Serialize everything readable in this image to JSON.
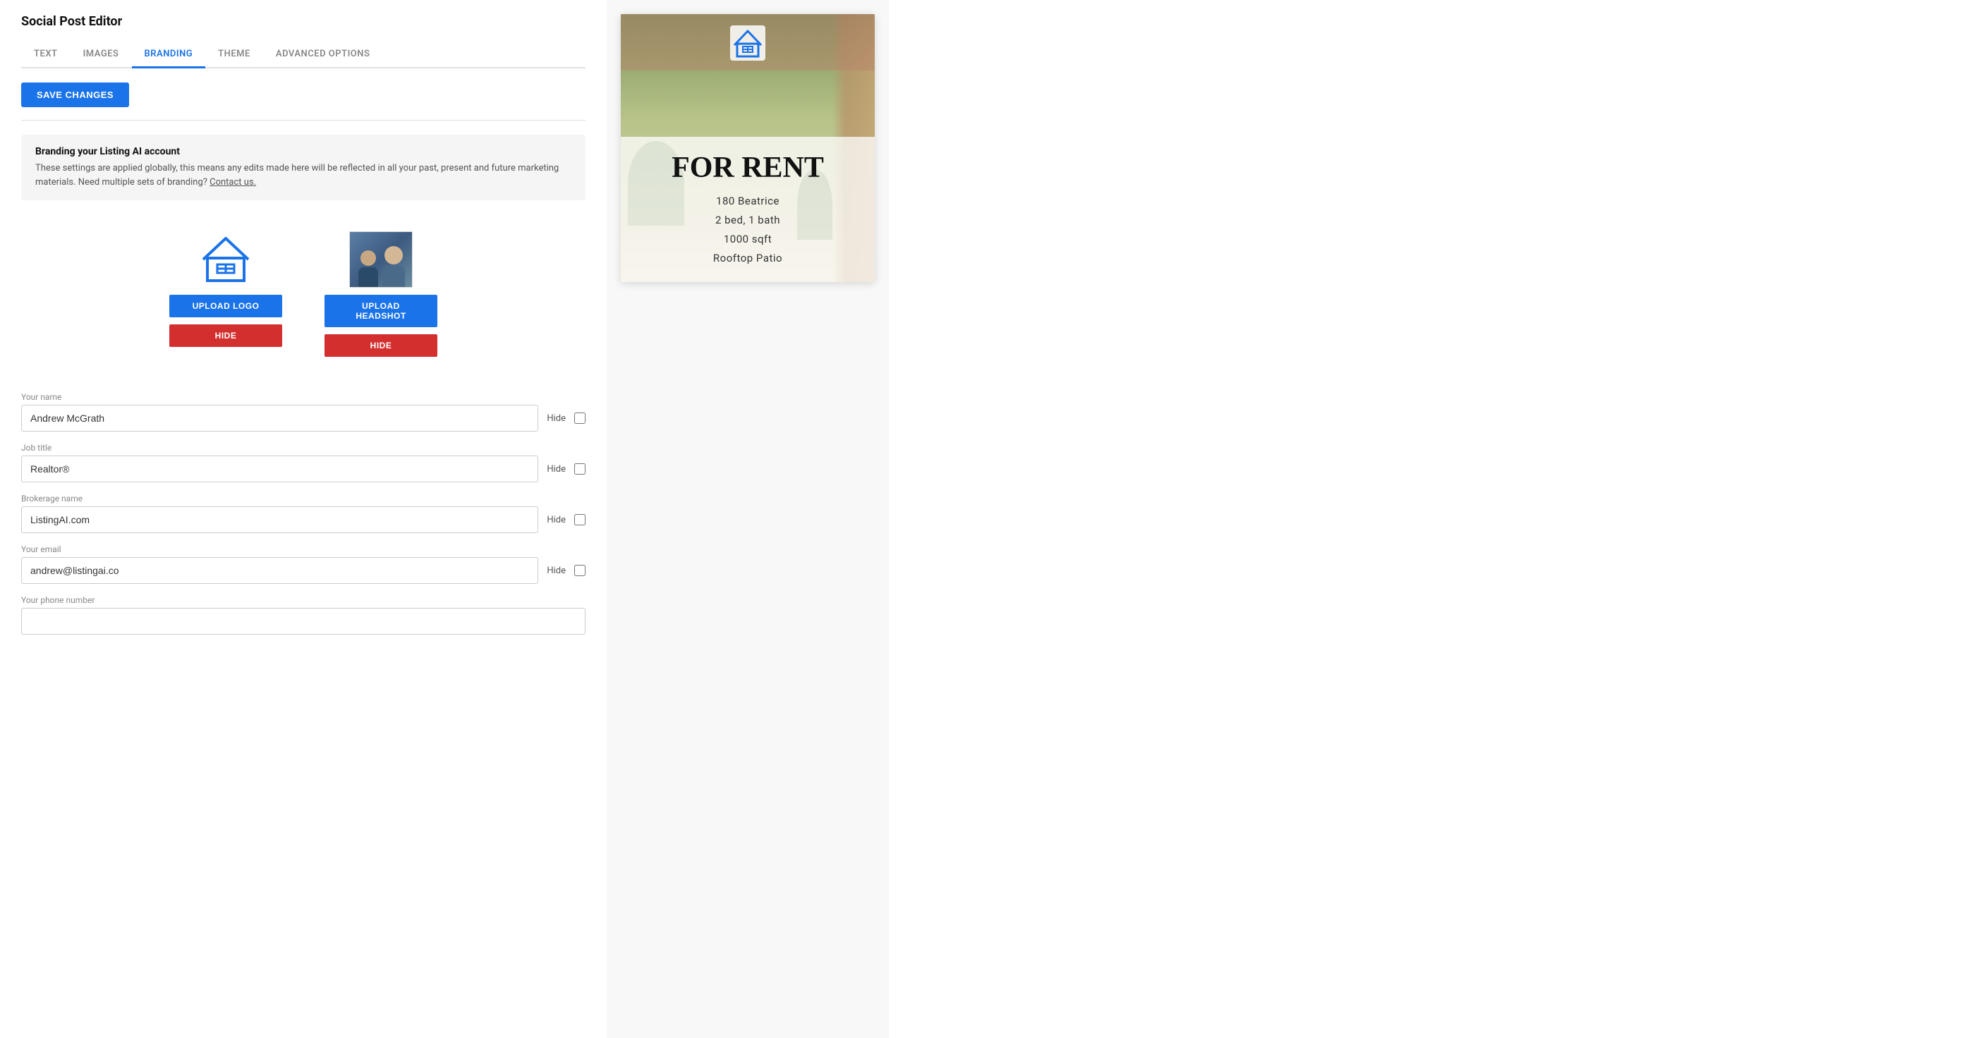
{
  "page": {
    "title": "Social Post Editor"
  },
  "tabs": [
    {
      "id": "text",
      "label": "TEXT",
      "active": false
    },
    {
      "id": "images",
      "label": "IMAGES",
      "active": false
    },
    {
      "id": "branding",
      "label": "BRANDING",
      "active": true
    },
    {
      "id": "theme",
      "label": "THEME",
      "active": false
    },
    {
      "id": "advanced",
      "label": "ADVANCED OPTIONS",
      "active": false
    }
  ],
  "toolbar": {
    "save_label": "SAVE CHANGES"
  },
  "info_box": {
    "title": "Branding your Listing AI account",
    "text": "These settings are applied globally, this means any edits made here will be reflected in all your past, present and future marketing materials. Need multiple sets of branding?",
    "link_text": "Contact us."
  },
  "upload": {
    "logo_btn": "UPLOAD LOGO",
    "headshot_btn": "UPLOAD HEADSHOT",
    "hide_logo_btn": "HIDE",
    "hide_headshot_btn": "HIDE"
  },
  "fields": [
    {
      "label": "Your name",
      "value": "Andrew McGrath",
      "hide": false
    },
    {
      "label": "Job title",
      "value": "Realtor®",
      "hide": false
    },
    {
      "label": "Brokerage name",
      "value": "ListingAI.com",
      "hide": false
    },
    {
      "label": "Your email",
      "value": "andrew@listingai.co",
      "hide": false
    },
    {
      "label": "Your phone number",
      "value": "",
      "hide": false
    }
  ],
  "preview": {
    "badge": "FOR RENT",
    "address": "180 Beatrice",
    "detail1": "2 bed, 1 bath",
    "detail2": "1000 sqft",
    "detail3": "Rooftop Patio"
  },
  "colors": {
    "accent": "#1a73e8",
    "upload_btn": "#1a73e8",
    "hide_btn": "#d32f2f",
    "tab_active": "#1a73e8"
  }
}
